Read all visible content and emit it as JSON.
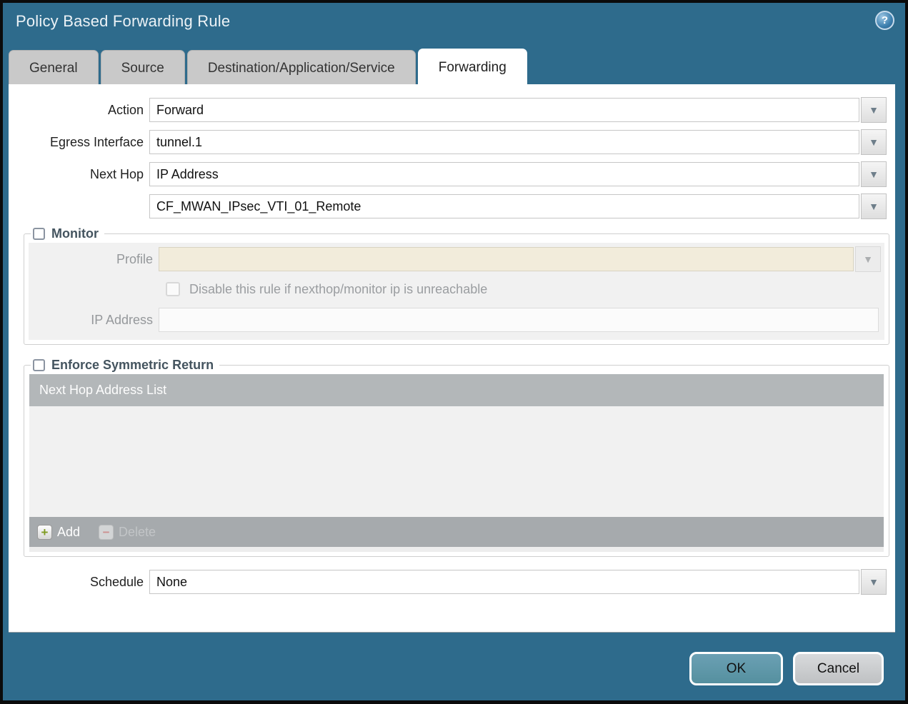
{
  "window": {
    "title": "Policy Based Forwarding Rule"
  },
  "icons": {
    "help": "?",
    "dropdown": "▼",
    "add": "+",
    "delete": "−"
  },
  "tabs": [
    {
      "label": "General",
      "active": false
    },
    {
      "label": "Source",
      "active": false
    },
    {
      "label": "Destination/Application/Service",
      "active": false
    },
    {
      "label": "Forwarding",
      "active": true
    }
  ],
  "form": {
    "action_label": "Action",
    "action_value": "Forward",
    "egress_label": "Egress Interface",
    "egress_value": "tunnel.1",
    "next_hop_label": "Next Hop",
    "next_hop_value": "IP Address",
    "next_hop_address_value": "CF_MWAN_IPsec_VTI_01_Remote",
    "schedule_label": "Schedule",
    "schedule_value": "None"
  },
  "monitor": {
    "legend": "Monitor",
    "checkbox_checked": false,
    "profile_label": "Profile",
    "profile_value": "",
    "disable_checkbox_label": "Disable this rule if nexthop/monitor ip is unreachable",
    "disable_checkbox_checked": false,
    "ip_address_label": "IP Address",
    "ip_address_value": ""
  },
  "symmetric_return": {
    "legend": "Enforce Symmetric Return",
    "checkbox_checked": false,
    "list_header": "Next Hop Address List",
    "rows": [],
    "add_label": "Add",
    "delete_label": "Delete"
  },
  "footer": {
    "ok_label": "OK",
    "cancel_label": "Cancel"
  },
  "colors": {
    "titlebar": "#2e6b8c",
    "ok_button": "#5e95ab",
    "disabled_profile_field": "#f2ecdb",
    "table_header": "#b3b7b9",
    "table_footer": "#a6aaad",
    "tab_inactive": "#c9c9c9"
  }
}
